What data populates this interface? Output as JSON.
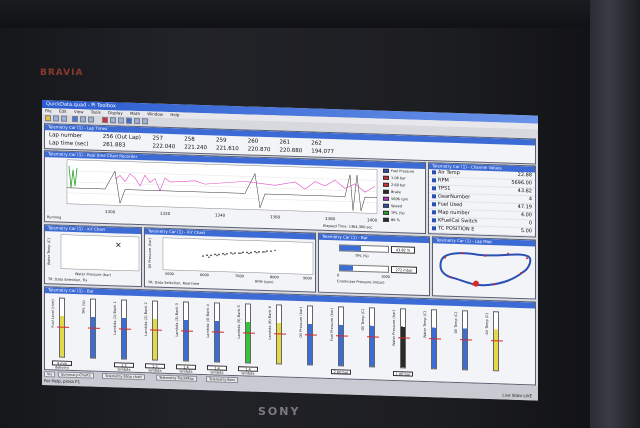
{
  "tv": {
    "brand_top": "BRAVIA",
    "brand_bottom": "SONY"
  },
  "app": {
    "title": "QuickData.quad - Pi Toolbox",
    "menu": [
      "File",
      "Edit",
      "View",
      "Tools",
      "Display",
      "Math",
      "Window",
      "Help"
    ]
  },
  "lap_panel": {
    "title": "Telemetry Car (1) - Lap Times",
    "lap_number_label": "Lap number",
    "lap_time_label": "Lap time (sec)",
    "laps": [
      {
        "number": "256 (Out Lap)",
        "time": "261.883"
      },
      {
        "number": "257",
        "time": "222.040"
      },
      {
        "number": "258",
        "time": "221.240"
      },
      {
        "number": "259",
        "time": "221.610"
      },
      {
        "number": "260",
        "time": "220.870"
      },
      {
        "number": "261",
        "time": "220.880"
      },
      {
        "number": "262",
        "time": "194.077"
      }
    ]
  },
  "strip_chart": {
    "title": "Telemetry Car (1) - Real time Chart Recorder",
    "status_left": "Running",
    "status_right": "Elapsed Time: 1364.300 sec",
    "x_ticks": [
      "1300",
      "1320",
      "1340",
      "1360",
      "1380",
      "1400"
    ],
    "legend": [
      {
        "label": "Fuel Pressure",
        "value": "",
        "color": "#2c4fb5"
      },
      {
        "label": "Oil Pressure",
        "value": "1.06 bar",
        "color": "#d63030"
      },
      {
        "label": "Oil Pressure",
        "value": "2.60 bar",
        "color": "#d63030"
      },
      {
        "label": "Brake",
        "value": "",
        "color": "#2a2a2a"
      },
      {
        "label": "",
        "value": "5696 rpm",
        "color": "#c433c4"
      },
      {
        "label": "Speed",
        "value": "",
        "color": "#2c4fb5"
      },
      {
        "label": "TPS",
        "value": "TPS (%)",
        "color": "#2aa42a"
      },
      {
        "label": "",
        "value": "86 %",
        "color": "#2a2a2a"
      }
    ]
  },
  "telemetry_panel": {
    "title": "Telemetry Car (1) - Channel Values",
    "rows": [
      {
        "label": "Air Temp",
        "value": "22.88"
      },
      {
        "label": "RPM",
        "value": "5696.00"
      },
      {
        "label": "TPS1",
        "value": "43.82"
      },
      {
        "label": "GearNumber",
        "value": "4"
      },
      {
        "label": "Fuel Used",
        "value": "47.19"
      },
      {
        "label": "Map number",
        "value": "4.00"
      },
      {
        "label": "KFuelCal Switch",
        "value": "0"
      },
      {
        "label": "TC POSITION E",
        "value": "5.00"
      }
    ]
  },
  "xy1": {
    "title": "Telemetry Car (1) - X-Y Chart",
    "ylabel": "Water Temp (C)",
    "xlabel": "Water Pressure (bar)",
    "footer": "TR: Data Selection, Fix"
  },
  "xy2": {
    "title": "Telemetry Car (1) - X-Y Chart",
    "ylabel": "Oil Pressure (bar)",
    "xlabel": "RPM (rpm)",
    "footer": "TR: Data Selection, Real-time",
    "x_ticks": [
      "5000",
      "6000",
      "7000",
      "8000",
      "9000"
    ]
  },
  "bars_panel": {
    "title": "Telemetry Car (1) - Bar",
    "top_label": "TPS (%)",
    "top_value": "43.82 %",
    "bottom_label": "Crankcase Pressure (mbar)",
    "bottom_value": "272 mbar",
    "ticks": [
      "0",
      "1000"
    ]
  },
  "map_panel": {
    "title": "Telemetry Car (1) - Lap Map"
  },
  "gauge_panel": {
    "title": "Telemetry Car (1) - Bar",
    "gauges": [
      {
        "label": "Fuel Level (mm)",
        "value": "4 mm delivery",
        "color": "#e2d84a"
      },
      {
        "label": "TPS (%)",
        "value": "",
        "color": "#3a6ed6"
      },
      {
        "label": "Lambda (1) Bank 1",
        "value": "1.5 lambda",
        "color": "#3a6ed6"
      },
      {
        "label": "Lambda (2) Bank 2",
        "value": "1.5 lambda",
        "color": "#e2d84a"
      },
      {
        "label": "Lambda (3) Bank 3",
        "value": "1.4 lambda",
        "color": "#3a6ed6"
      },
      {
        "label": "Lambda (4) Bank 4",
        "value": "1.4 lambda",
        "color": "#3a6ed6"
      },
      {
        "label": "Lambda (5) Bank 5",
        "value": "1.4 lambda",
        "color": "#36c23a"
      },
      {
        "label": "Lambda (6) Bank 6",
        "value": "",
        "color": "#e2d84a"
      },
      {
        "label": "Oil Pressure (bar)",
        "value": "",
        "color": "#3a6ed6"
      },
      {
        "label": "Fuel Pressure (bar)",
        "value": "2.60 bar",
        "color": "#3a6ed6"
      },
      {
        "label": "Oil Temp (C)",
        "value": "",
        "color": "#3a6ed6"
      },
      {
        "label": "Water Pressure (bar)",
        "value": "1.06 bar",
        "color": "#2a2a2a"
      },
      {
        "label": "Water Temp (C)",
        "value": "",
        "color": "#3a6ed6"
      },
      {
        "label": "Oil Temp (C)",
        "value": "",
        "color": "#3a6ed6"
      },
      {
        "label": "Air Temp (C)",
        "value": "",
        "color": "#e2d84a"
      }
    ]
  },
  "taskbar": {
    "tabs": [
      "Vis",
      "Summary-Charts",
      "Telemetry-Strip chart",
      "Telemetry-TrackMap",
      "Telemetry-Bars"
    ],
    "status_left": "For Help, press F1",
    "status_right": "Live Stats LIVE"
  },
  "colors": {
    "accent": "#3d6bd6",
    "trace_pink": "#e04fc6",
    "trace_green": "#2aa42a",
    "marker_red": "#d62a2a"
  }
}
